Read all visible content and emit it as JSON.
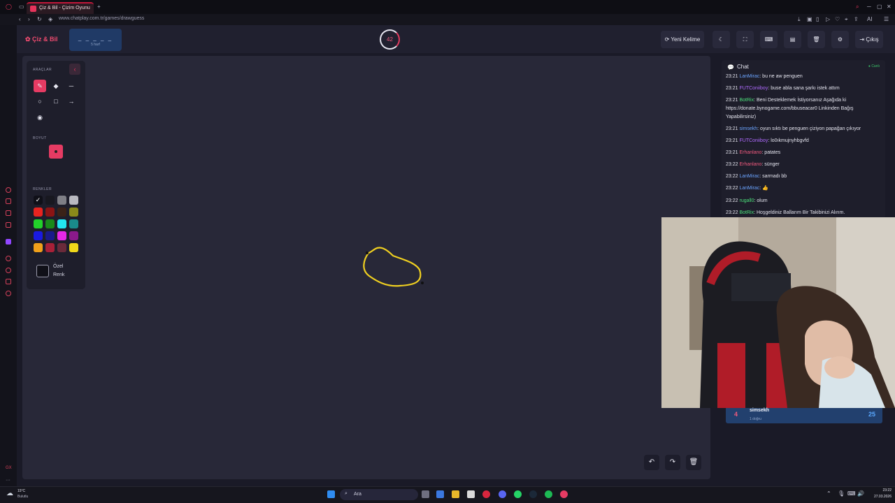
{
  "browser": {
    "tab_title": "Çiz & Bil - Çizim Oyunu",
    "new_tab": "+",
    "url": "www.chatplay.com.tr/games/drawguess",
    "ai_label": "AI"
  },
  "header": {
    "logo": "Çiz & Bil",
    "word_mask": "_ _ _ _ _",
    "word_hint": "5 harf",
    "timer": "42",
    "new_word": "Yeni Kelime",
    "logout": "Çıkış"
  },
  "tools": {
    "title": "ARAÇLAR",
    "size_title": "BOYUT",
    "colors_title": "RENKLER",
    "custom_color": "Özel Renk",
    "colors": [
      [
        "#101018",
        "#181820",
        "#7f7f86",
        "#b9b9c0"
      ],
      [
        "#e82420",
        "#8a1414",
        "#3a2218",
        "#8a8a1a"
      ],
      [
        "#22d22a",
        "#1a8a1a",
        "#22e6f0",
        "#1a8a8a"
      ],
      [
        "#1a1ae0",
        "#1a1a8a",
        "#e628e6",
        "#8a1a8a"
      ],
      [
        "#f0a01a",
        "#a82038",
        "#6a2a3a",
        "#f0d81a"
      ]
    ]
  },
  "chat": {
    "title": "Chat",
    "status": "Canlı",
    "messages": [
      {
        "time": "23:21",
        "user": "LanMirac",
        "color": "#6ba4ff",
        "text": ": bu ne aw penguen"
      },
      {
        "time": "23:21",
        "user": "FUTConiiboy",
        "color": "#b06bff",
        "text": ": buse abla sana şarkı istek attım"
      },
      {
        "time": "23:21",
        "user": "BotRix",
        "color": "#4ce07a",
        "text": ": Beni Desteklemek İstiyorsanız Aşağıda ki https://donate.bynogame.com/bbuseacar0 Linkinden Bağış Yapabilirsiniz)"
      },
      {
        "time": "23:21",
        "user": "simsekh",
        "color": "#6ba4ff",
        "text": ": oyun sıktı be penguen çiziyon papağan çıkıyor"
      },
      {
        "time": "23:21",
        "user": "FUTConiiboy",
        "color": "#b06bff",
        "text": ": lo0ıkmujnyhbgvfd"
      },
      {
        "time": "23:21",
        "user": "Erhanlano",
        "color": "#f05a7e",
        "text": ": patates"
      },
      {
        "time": "23:22",
        "user": "Erhanlano",
        "color": "#f05a7e",
        "text": ": sünger"
      },
      {
        "time": "23:22",
        "user": "LanMirac",
        "color": "#6ba4ff",
        "text": ": sarmadı bb"
      },
      {
        "time": "23:22",
        "user": "LanMirac",
        "color": "#6ba4ff",
        "text": ": 👍"
      },
      {
        "time": "23:22",
        "user": "rugall0",
        "color": "#4ce07a",
        "text": ": olum"
      },
      {
        "time": "23:22",
        "user": "BotRix",
        "color": "#4ce07a",
        "text": ": Hoşgeldiniz Ballarım Bir Takibinizi Alırım."
      }
    ]
  },
  "leaderboard": {
    "rank": "4",
    "name": "simsekh",
    "sub": "1 doğru",
    "score": "25"
  },
  "taskbar": {
    "weather_temp": "15°C",
    "weather_desc": "Bulutlu",
    "search": "Ara",
    "time": "23:22",
    "date": "27.03.2026"
  }
}
